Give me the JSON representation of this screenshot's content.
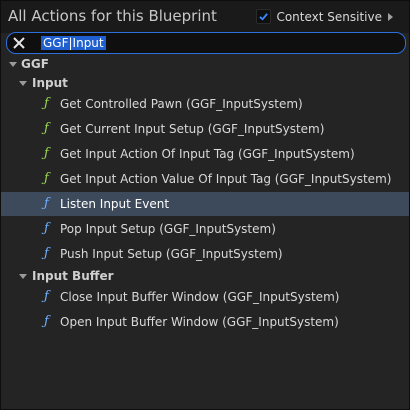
{
  "header": {
    "title": "All Actions for this Blueprint",
    "context_label": "Context Sensitive",
    "context_checked": true
  },
  "search": {
    "value": "GGF|Input"
  },
  "tree": {
    "root_label": "GGF",
    "categories": [
      {
        "label": "Input",
        "items": [
          {
            "label": "Get Controlled Pawn (GGF_InputSystem)",
            "icon": "function-icon",
            "color": "#9ad84e"
          },
          {
            "label": "Get Current Input Setup (GGF_InputSystem)",
            "icon": "function-icon",
            "color": "#9ad84e"
          },
          {
            "label": "Get Input Action Of Input Tag (GGF_InputSystem)",
            "icon": "function-icon",
            "color": "#9ad84e"
          },
          {
            "label": "Get Input Action Value Of Input Tag (GGF_InputSystem)",
            "icon": "function-icon",
            "color": "#9ad84e"
          },
          {
            "label": "Listen Input Event",
            "icon": "function-icon",
            "color": "#6fb0ff",
            "selected": true
          },
          {
            "label": "Pop Input Setup (GGF_InputSystem)",
            "icon": "function-icon",
            "color": "#6fb0ff"
          },
          {
            "label": "Push Input Setup (GGF_InputSystem)",
            "icon": "function-icon",
            "color": "#6fb0ff"
          }
        ]
      },
      {
        "label": "Input Buffer",
        "items": [
          {
            "label": "Close Input Buffer Window (GGF_InputSystem)",
            "icon": "function-icon",
            "color": "#6fb0ff"
          },
          {
            "label": "Open Input Buffer Window (GGF_InputSystem)",
            "icon": "function-icon",
            "color": "#6fb0ff"
          }
        ]
      }
    ]
  },
  "icons": {
    "function_glyph": "ƒ"
  }
}
